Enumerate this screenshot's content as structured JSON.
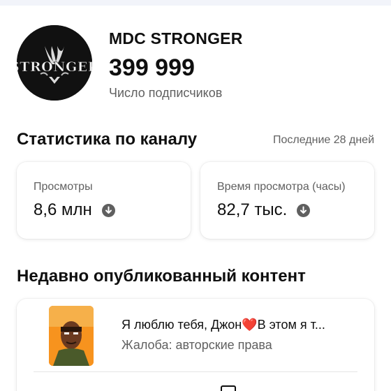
{
  "channel": {
    "name": "MDC STRONGER",
    "subscriber_count": "399 999",
    "subscriber_label": "Число подписчиков",
    "avatar_text": "STRONGER"
  },
  "stats": {
    "title": "Статистика по каналу",
    "period": "Последние 28 дней",
    "cards": [
      {
        "label": "Просмотры",
        "value": "8,6 млн",
        "trend": "down"
      },
      {
        "label": "Время просмотра (часы)",
        "value": "82,7 тыс.",
        "trend": "down"
      }
    ]
  },
  "recent": {
    "title": "Недавно опубликованный контент",
    "items": [
      {
        "title": "Я люблю тебя, Джон❤️В этом я т...",
        "status": "Жалоба: авторские права"
      }
    ]
  },
  "colors": {
    "background": "#ffffff",
    "text_primary": "#0f0f0f",
    "text_secondary": "#606060",
    "trend_icon": "#5f5f5f",
    "avatar_bg": "#111111",
    "thumbnail_bg": "#ff8a1f"
  }
}
